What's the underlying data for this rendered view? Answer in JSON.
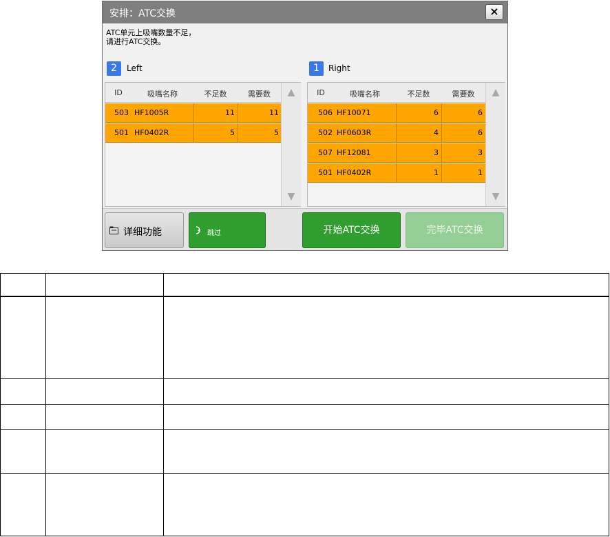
{
  "dialog": {
    "title": "安排：ATC交换",
    "close_label": "×",
    "message": "ATC单元上吸嘴数量不足，\n请进行ATC交换。"
  },
  "left": {
    "badge": "2",
    "label": "Left",
    "columns": [
      "ID",
      "吸嘴名称",
      "不足数",
      "需要数"
    ],
    "rows": [
      {
        "id": "503",
        "name": "HF1005R",
        "short": "11",
        "need": "11"
      },
      {
        "id": "501",
        "name": "HF0402R",
        "short": "5",
        "need": "5"
      }
    ]
  },
  "right": {
    "badge": "1",
    "label": "Right",
    "columns": [
      "ID",
      "吸嘴名称",
      "不足数",
      "需要数"
    ],
    "rows": [
      {
        "id": "506",
        "name": "HF10071",
        "short": "6",
        "need": "6"
      },
      {
        "id": "502",
        "name": "HF0603R",
        "short": "4",
        "need": "6"
      },
      {
        "id": "507",
        "name": "HF12081",
        "short": "3",
        "need": "3"
      },
      {
        "id": "501",
        "name": "HF0402R",
        "short": "1",
        "need": "1"
      }
    ]
  },
  "buttons": {
    "detail": "详细功能",
    "skip": "跳过",
    "start": "开始ATC交换",
    "finish": "完毕ATC交换"
  },
  "icons": {
    "scroll_up": "up-arrow-icon",
    "scroll_down": "down-arrow-icon",
    "detail": "folder-icon",
    "skip": "skip-icon"
  },
  "colors": {
    "row_highlight": "#ffa500",
    "primary_green": "#2f9e2f",
    "disabled_green": "#95cf95",
    "badge_blue": "#3b78e7",
    "titlebar": "#7f7f7f"
  }
}
